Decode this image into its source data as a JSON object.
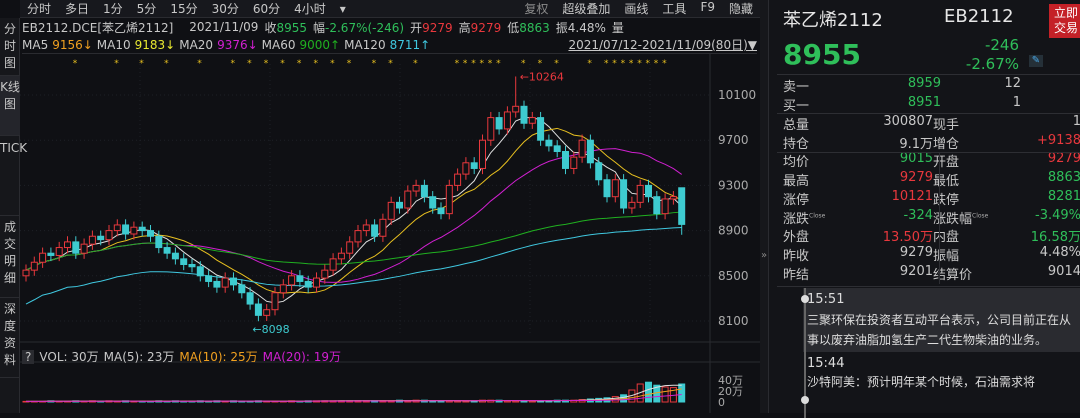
{
  "toolbar": {
    "periods": [
      "分时",
      "多日",
      "1分",
      "5分",
      "15分",
      "30分",
      "60分",
      "4小时"
    ],
    "more": "▾",
    "tools": [
      "复权",
      "超级叠加",
      "画线",
      "工具",
      "F9",
      "隐藏"
    ]
  },
  "vtabs": [
    "分时图",
    "K线图",
    "TICK",
    "成交明细",
    "深度资料"
  ],
  "info": {
    "symbol": "EB2112.DCE[苯乙烯2112]",
    "date": "2021/11/09",
    "close_label": "收",
    "close": "8955",
    "chg_label": "幅",
    "chg": "-2.67%(-246)",
    "open_label": "开",
    "open": "9279",
    "high_label": "高",
    "high": "9279",
    "low_label": "低",
    "low": "8863",
    "amp_label": "振",
    "amp": "4.48%",
    "vol_label": "量"
  },
  "ma": [
    {
      "label": "MA5",
      "value": "9156↓",
      "color": "#f0a020"
    },
    {
      "label": "MA10",
      "value": "9183↓",
      "color": "#e8e830"
    },
    {
      "label": "MA20",
      "value": "9376↓",
      "color": "#d020d0"
    },
    {
      "label": "MA60",
      "value": "9000↑",
      "color": "#20b020"
    },
    {
      "label": "MA120",
      "value": "8711↑",
      "color": "#40c8e0"
    }
  ],
  "range": "2021/07/12-2021/11/09(80日)▼",
  "annotations": {
    "high": "10264",
    "low": "8098"
  },
  "vol_header": {
    "q": "?",
    "vol": "VOL: 30万",
    "ma5": "MA(5): 23万",
    "ma10": "MA(10): 25万",
    "ma20": "MA(20): 19万"
  },
  "chart_data": {
    "type": "candlestick",
    "y_ticks": [
      10100,
      9700,
      9300,
      8900,
      8500,
      8100
    ],
    "ylim": [
      8050,
      10400
    ],
    "vol_ticks": [
      "40万",
      "20万",
      "0"
    ],
    "candles": [
      [
        8500,
        8600,
        8450,
        8550
      ],
      [
        8550,
        8670,
        8500,
        8620
      ],
      [
        8620,
        8750,
        8570,
        8700
      ],
      [
        8700,
        8750,
        8630,
        8680
      ],
      [
        8680,
        8800,
        8630,
        8750
      ],
      [
        8750,
        8850,
        8700,
        8800
      ],
      [
        8800,
        8850,
        8650,
        8700
      ],
      [
        8700,
        8830,
        8650,
        8780
      ],
      [
        8780,
        8900,
        8730,
        8850
      ],
      [
        8850,
        8900,
        8770,
        8820
      ],
      [
        8820,
        8950,
        8770,
        8900
      ],
      [
        8900,
        9000,
        8850,
        8950
      ],
      [
        8950,
        9000,
        8820,
        8870
      ],
      [
        8870,
        8980,
        8820,
        8930
      ],
      [
        8930,
        8980,
        8850,
        8900
      ],
      [
        8900,
        8950,
        8800,
        8850
      ],
      [
        8850,
        8900,
        8700,
        8750
      ],
      [
        8750,
        8800,
        8650,
        8700
      ],
      [
        8700,
        8750,
        8600,
        8650
      ],
      [
        8650,
        8700,
        8550,
        8600
      ],
      [
        8600,
        8650,
        8530,
        8580
      ],
      [
        8580,
        8630,
        8450,
        8500
      ],
      [
        8500,
        8550,
        8400,
        8450
      ],
      [
        8450,
        8500,
        8350,
        8400
      ],
      [
        8400,
        8530,
        8350,
        8480
      ],
      [
        8480,
        8530,
        8370,
        8420
      ],
      [
        8420,
        8470,
        8300,
        8350
      ],
      [
        8350,
        8400,
        8200,
        8250
      ],
      [
        8250,
        8300,
        8098,
        8150
      ],
      [
        8150,
        8250,
        8100,
        8200
      ],
      [
        8200,
        8400,
        8150,
        8350
      ],
      [
        8350,
        8470,
        8300,
        8420
      ],
      [
        8420,
        8550,
        8370,
        8500
      ],
      [
        8500,
        8550,
        8400,
        8450
      ],
      [
        8450,
        8500,
        8350,
        8400
      ],
      [
        8400,
        8530,
        8350,
        8480
      ],
      [
        8480,
        8600,
        8430,
        8550
      ],
      [
        8550,
        8700,
        8500,
        8650
      ],
      [
        8650,
        8750,
        8600,
        8700
      ],
      [
        8700,
        8850,
        8650,
        8800
      ],
      [
        8800,
        8950,
        8750,
        8900
      ],
      [
        8900,
        9000,
        8850,
        8950
      ],
      [
        8950,
        9000,
        8800,
        8850
      ],
      [
        8850,
        9050,
        8800,
        9000
      ],
      [
        9000,
        9200,
        8950,
        9150
      ],
      [
        9150,
        9200,
        9050,
        9100
      ],
      [
        9100,
        9300,
        9050,
        9250
      ],
      [
        9250,
        9350,
        9200,
        9300
      ],
      [
        9300,
        9350,
        9150,
        9200
      ],
      [
        9200,
        9250,
        9050,
        9100
      ],
      [
        9100,
        9150,
        9000,
        9050
      ],
      [
        9050,
        9350,
        9000,
        9300
      ],
      [
        9300,
        9450,
        9250,
        9400
      ],
      [
        9400,
        9550,
        9350,
        9500
      ],
      [
        9500,
        9550,
        9400,
        9450
      ],
      [
        9450,
        9750,
        9400,
        9700
      ],
      [
        9700,
        9950,
        9650,
        9900
      ],
      [
        9900,
        9950,
        9750,
        9800
      ],
      [
        9800,
        10000,
        9750,
        9950
      ],
      [
        9950,
        10264,
        9900,
        10000
      ],
      [
        10000,
        10050,
        9800,
        9850
      ],
      [
        9850,
        9950,
        9800,
        9900
      ],
      [
        9900,
        9950,
        9650,
        9700
      ],
      [
        9700,
        9750,
        9600,
        9650
      ],
      [
        9650,
        9700,
        9550,
        9600
      ],
      [
        9600,
        9650,
        9400,
        9450
      ],
      [
        9450,
        9600,
        9400,
        9550
      ],
      [
        9550,
        9750,
        9500,
        9700
      ],
      [
        9700,
        9750,
        9450,
        9500
      ],
      [
        9500,
        9550,
        9300,
        9350
      ],
      [
        9350,
        9400,
        9150,
        9200
      ],
      [
        9200,
        9400,
        9150,
        9350
      ],
      [
        9350,
        9400,
        9050,
        9100
      ],
      [
        9100,
        9200,
        9050,
        9150
      ],
      [
        9150,
        9350,
        9100,
        9300
      ],
      [
        9300,
        9350,
        9150,
        9200
      ],
      [
        9200,
        9250,
        9000,
        9050
      ],
      [
        9050,
        9230,
        9000,
        9180
      ],
      [
        9180,
        9250,
        9130,
        9201
      ],
      [
        9279,
        9279,
        8863,
        8955
      ]
    ],
    "volume": [
      1,
      1,
      1,
      2,
      1,
      1,
      2,
      1,
      2,
      1,
      2,
      1,
      2,
      1,
      1,
      1,
      2,
      1,
      2,
      1,
      1,
      2,
      1,
      2,
      1,
      2,
      1,
      1,
      2,
      1,
      1,
      1,
      2,
      1,
      2,
      2,
      2,
      2,
      2,
      2,
      2,
      2,
      2,
      2,
      2,
      3,
      2,
      3,
      3,
      2,
      2,
      2,
      2,
      2,
      2,
      3,
      3,
      3,
      2,
      2,
      2,
      2,
      2,
      2,
      3,
      3,
      3,
      4,
      5,
      6,
      7,
      9,
      12,
      20,
      30,
      33,
      28,
      25,
      24,
      30
    ]
  },
  "right": {
    "name": "苯乙烯2112",
    "code": "EB2112",
    "trade": "立即交易",
    "price": "8955",
    "chg": "-246",
    "pct": "-2.67%",
    "book": [
      {
        "label": "卖一",
        "price": "8959",
        "qty": "12"
      },
      {
        "label": "买一",
        "price": "8951",
        "qty": "1"
      }
    ],
    "stats": [
      [
        {
          "l": "总量",
          "v": "300807",
          "c": "w"
        },
        {
          "l": "现手",
          "v": "1",
          "c": "w"
        }
      ],
      [
        {
          "l": "持仓",
          "v": "9.1万",
          "c": "w"
        },
        {
          "l": "增仓",
          "v": "+9138",
          "c": "r"
        }
      ],
      [
        {
          "l": "均价",
          "v": "9015",
          "c": "g"
        },
        {
          "l": "开盘",
          "v": "9279",
          "c": "r"
        }
      ],
      [
        {
          "l": "最高",
          "v": "9279",
          "c": "r"
        },
        {
          "l": "最低",
          "v": "8863",
          "c": "g"
        }
      ],
      [
        {
          "l": "涨停",
          "v": "10121",
          "c": "r"
        },
        {
          "l": "跌停",
          "v": "8281",
          "c": "g"
        }
      ],
      [
        {
          "l": "涨跌",
          "s": "Close",
          "v": "-324",
          "c": "g"
        },
        {
          "l": "涨跌幅",
          "s": "Close",
          "v": "-3.49%",
          "c": "g"
        }
      ],
      [
        {
          "l": "外盘",
          "v": "13.50万",
          "c": "r"
        },
        {
          "l": "内盘",
          "v": "16.58万",
          "c": "g"
        }
      ],
      [
        {
          "l": "昨收",
          "v": "9279",
          "c": "w"
        },
        {
          "l": "振幅",
          "v": "4.48%",
          "c": "w"
        }
      ],
      [
        {
          "l": "昨结",
          "v": "9201",
          "c": "w"
        },
        {
          "l": "结算价",
          "v": "9014",
          "c": "w"
        }
      ]
    ],
    "news": [
      {
        "time": "15:51",
        "text": "三聚环保在投资者互动平台表示，公司目前正在从事以废弃油脂加氢生产二代生物柴油的业务。"
      },
      {
        "time": "15:44",
        "text": "沙特阿美：预计明年某个时候，石油需求将"
      }
    ]
  }
}
